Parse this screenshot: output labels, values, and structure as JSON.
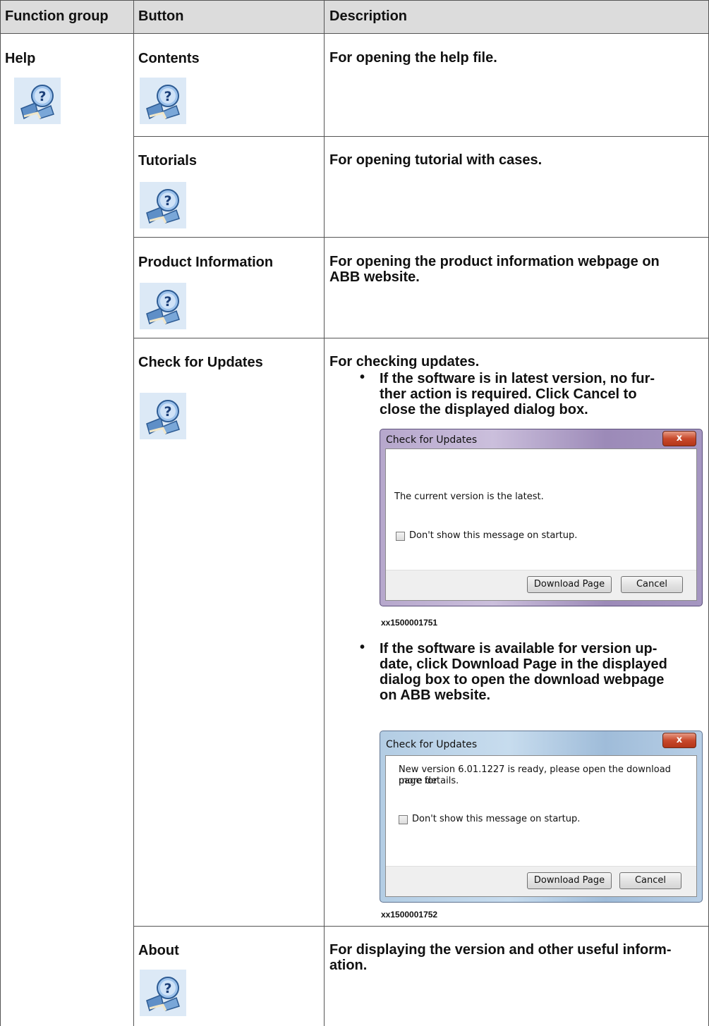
{
  "table": {
    "headers": [
      "Function group",
      "Button",
      "Description"
    ],
    "function_group": "Help",
    "rows": [
      {
        "button": "Contents",
        "description": "For opening the help file."
      },
      {
        "button": "Tutorials",
        "description": "For opening tutorial with cases."
      },
      {
        "button": "Product Information",
        "description_line1": "For opening the product information webpage on",
        "description_line2": "ABB website."
      },
      {
        "button": "Check for Updates",
        "description": "For checking updates."
      },
      {
        "button": "About",
        "description_line1": "For displaying the version and other useful inform-",
        "description_line2": "ation."
      }
    ]
  },
  "bullets": {
    "b1": {
      "line1": "If the software is in latest version, no fur-",
      "line2": "ther action is required. Click ",
      "bold": "Cancel",
      "line2b": " to",
      "line3": "close the displayed dialog box."
    },
    "b2": {
      "line1": "If the software is available for version up-",
      "line2a": "date, click ",
      "bold": "Download Page",
      "line2b": " in the displayed",
      "line3": "dialog box to open the download webpage",
      "line4": "on ABB website."
    }
  },
  "dialog1": {
    "title": "Check for Updates",
    "close": "x",
    "message": "The current version is the latest.",
    "checkbox_label": "Don't show this message on startup.",
    "download_button": "Download Page",
    "cancel_button": "Cancel",
    "caption": "xx1500001751"
  },
  "dialog2": {
    "title": "Check for Updates",
    "close": "x",
    "message_line1": "New version 6.01.1227 is ready, please open the download page for",
    "message_line2": "more details.",
    "checkbox_label": "Don't show this message on startup.",
    "download_button": "Download Page",
    "cancel_button": "Cancel",
    "caption": "xx1500001752"
  },
  "icon_name": "help-book-icon"
}
